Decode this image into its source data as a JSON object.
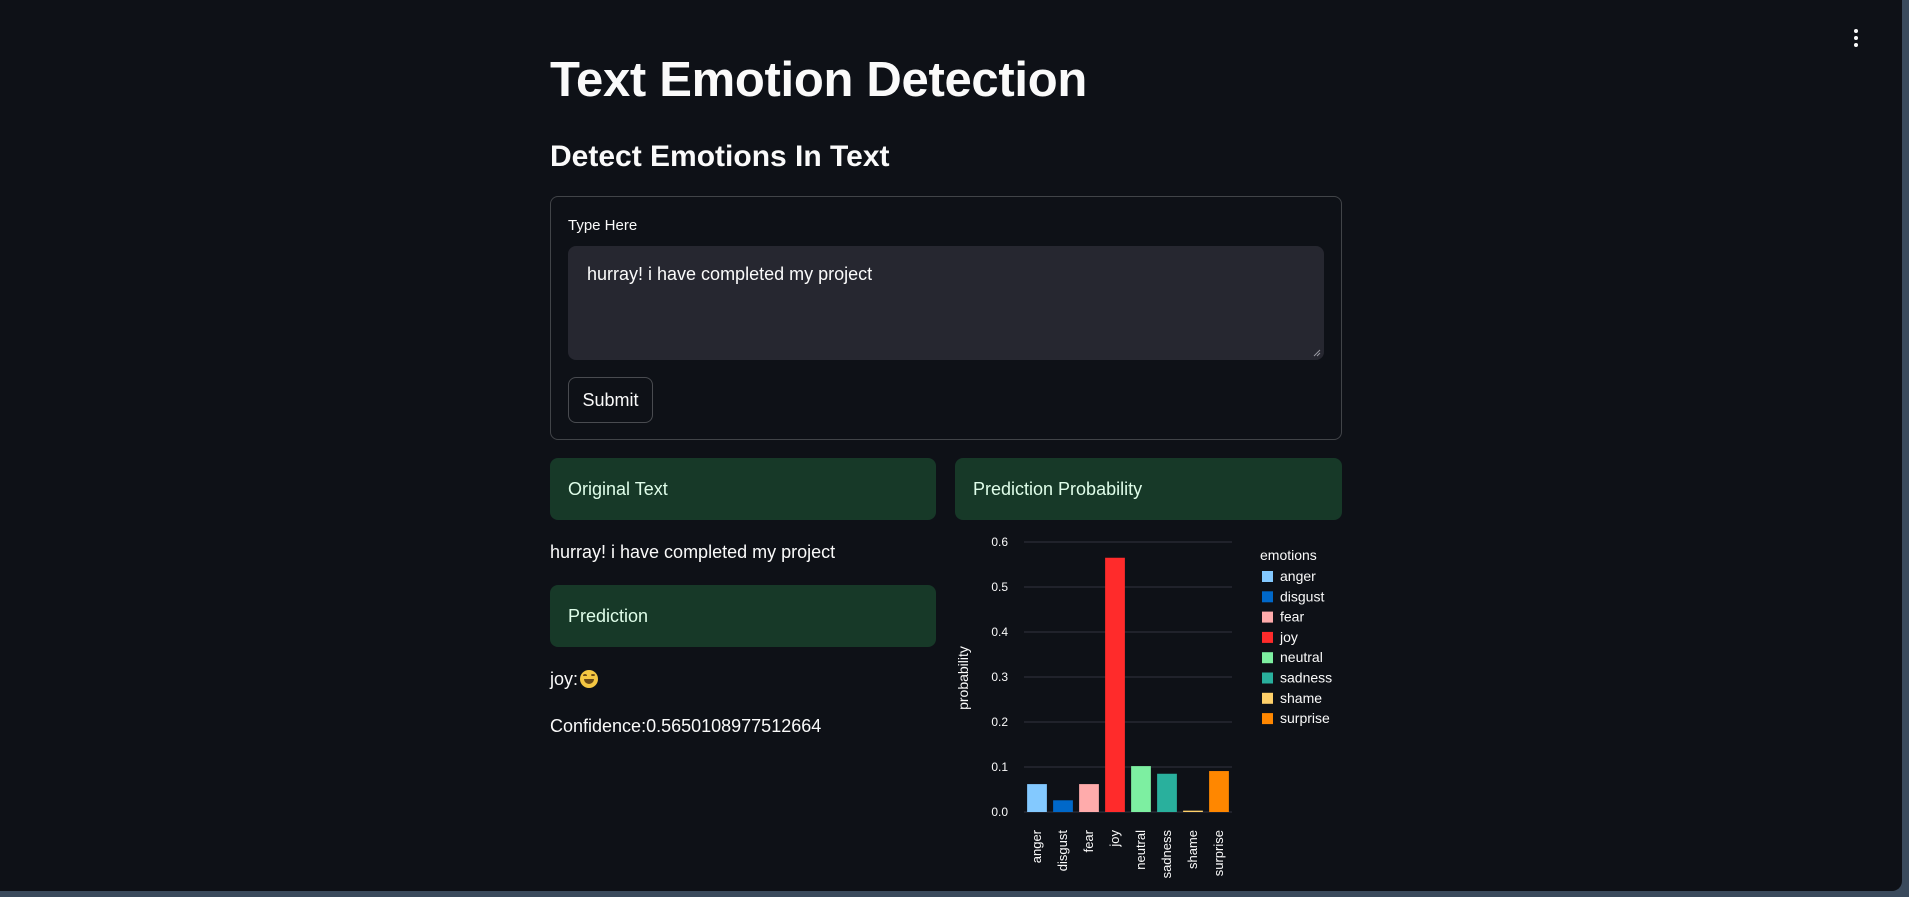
{
  "app": {
    "title": "Text Emotion Detection",
    "subtitle": "Detect Emotions In Text",
    "menu_icon": "vertical-ellipsis-icon"
  },
  "form": {
    "label": "Type Here",
    "input_value": "hurray! i have completed my project",
    "submit_label": "Submit"
  },
  "results": {
    "original_header": "Original Text",
    "original_text": "hurray! i have completed my project",
    "prediction_header": "Prediction",
    "prediction_value": "joy:",
    "prediction_emoji": "face-with-tears-of-joy-icon",
    "confidence": "Confidence:0.5650108977512664",
    "probability_header": "Prediction Probability"
  },
  "chart_data": {
    "type": "bar",
    "xlabel": "",
    "ylabel": "probability",
    "legend_title": "emotions",
    "legend_placement": "right",
    "categories": [
      "anger",
      "disgust",
      "fear",
      "joy",
      "neutral",
      "sadness",
      "shame",
      "surprise"
    ],
    "values": [
      0.062,
      0.026,
      0.062,
      0.565,
      0.102,
      0.085,
      0.003,
      0.091
    ],
    "colors": [
      "#83c9ff",
      "#0068c9",
      "#ffabab",
      "#ff2b2b",
      "#7defa1",
      "#29b09d",
      "#ffd16a",
      "#ff8700"
    ],
    "yticks": [
      "0.0",
      "0.1",
      "0.2",
      "0.3",
      "0.4",
      "0.5",
      "0.6"
    ],
    "ylim": [
      0,
      0.6
    ],
    "grid": true
  }
}
